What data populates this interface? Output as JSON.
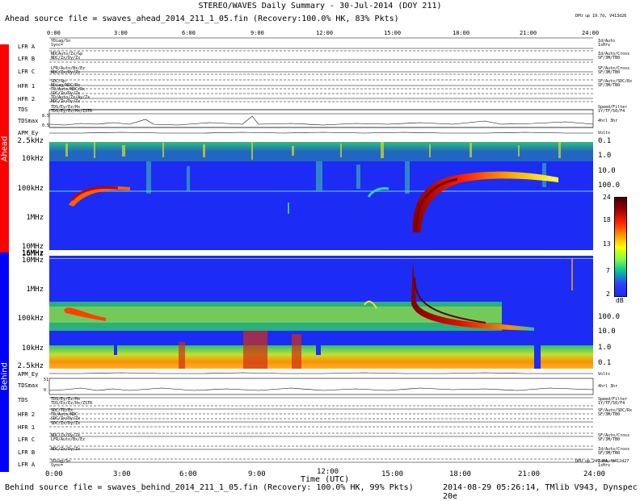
{
  "title": "STEREO/WAVES Daily Summary - 30-Jul-2014 (DOY 211)",
  "ahead_source": "Ahead source file = swaves_ahead_2014_211_1_05.fin (Recovery:100.0% HK, 83% Pkts)",
  "behind_source": "Behind source file = swaves_behind_2014_211_1_05.fin (Recovery: 100.0% HK, 99% Pkts)",
  "footer_right": "2014-08-29 05:26:14, TMlib V943, Dynspec 20e",
  "top_right_info": "DPU up 19.7d, V413d26",
  "bottom_right_info": "DPU up 249.4d, V412d27",
  "time_ticks": [
    "0:00",
    "3:00",
    "6:00",
    "9:00",
    "12:00",
    "15:00",
    "18:00",
    "21:00",
    "24:00"
  ],
  "time_axis_label": "Time (UTC)",
  "time_axis_overlay": "12:00",
  "side_labels": {
    "ahead": "Ahead",
    "behind": "Behind"
  },
  "ahead_channels": [
    "LFR A",
    "LFR B",
    "LFR C",
    "HFR 1",
    "HFR 2",
    "TDS",
    "TDSmax",
    "APM_Ey"
  ],
  "behind_channels": [
    "APM_Ey",
    "TDSmax",
    "TDS",
    "HFR 2",
    "HFR 1",
    "LFR C",
    "LFR B",
    "LFR A"
  ],
  "ahead_freq_labels": [
    "2.5kHz",
    "10kHz",
    "100kHz",
    "1MHz",
    "10MHz",
    "16MHz"
  ],
  "behind_freq_labels": [
    "16MHz",
    "10MHz",
    "1MHz",
    "100kHz",
    "10kHz",
    "2.5kHz"
  ],
  "ahead_right_labels": [
    "0.1",
    "1.0",
    "10.0",
    "100.0"
  ],
  "behind_right_labels": [
    "100.0",
    "10.0",
    "1.0",
    "0.1"
  ],
  "colorbar": {
    "ticks": [
      "24",
      "18",
      "13",
      "7",
      "2"
    ],
    "unit": "dB"
  },
  "tds_axis": {
    "top": "8.5",
    "bottom": "0.5"
  },
  "tdsmax_axis": {
    "top": "51",
    "bottom": "0"
  },
  "ahead_row_notes": [
    "YDiag/Sn",
    "Sync=",
    "NDCAuto/Zx/Gp",
    "NDC/Zx/Dy/Zx",
    "LFR/Auto/Bx/Ez",
    "NDC/Zx/Dy/Zx",
    "SDC/Gp-",
    "NDiag/NDC/Rx",
    "TD/Auto/NDC/Rx",
    "SDC/Zx/Dy/Zx",
    "TD/Auto/Zx/Ay/Zx",
    "NDC/Zx/Dy/Zx",
    "TDS/Ey/Ez/Hx",
    "TDS/Ey/Ez/Hx/ZSTR"
  ],
  "behind_row_notes": [
    "TDS/Ey/Ez/Hx",
    "TDS/Ex/Ez/Hx/ZSTR",
    "SDC/TD/Ex",
    "TD/Auto/NDC",
    "SDC/Zx/Dy/Zx",
    "SDC/Zx/Dy/Zx",
    "NDC/Zx/Dy/Zx",
    "LFR/Auto/Bx/Ez",
    "NDC/Zx/Dy/Zx",
    "YDiag/Sn",
    "Sync="
  ],
  "right_row_notes": [
    "Id/Auto",
    "1sHrv",
    "Id/Auto/Cross",
    "SF/3M/TB0",
    "SF/Auto/Cross",
    "SF/3M/TB0",
    "SF/Auto/SDC/Rx",
    "SF/3M/TB0",
    "Speed/Filter",
    "1Y/TF/50/F4",
    "4hrl 3hr",
    "Volts"
  ],
  "colors": {
    "ahead_bar": "#ff0000",
    "behind_bar": "#0000ff",
    "background_blue": "#1c2cf4"
  }
}
